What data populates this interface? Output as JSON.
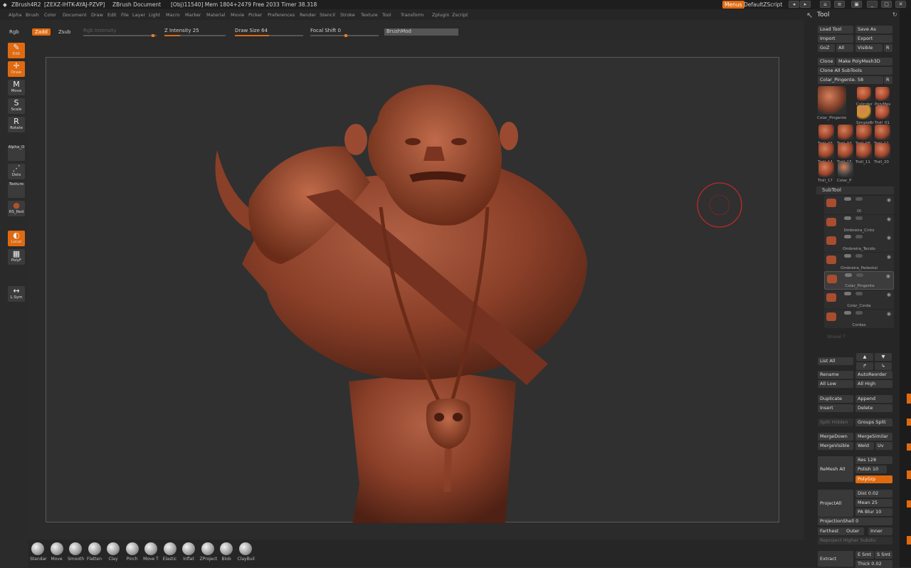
{
  "titlebar": {
    "app": "ZBrush4R2",
    "serial": "[ZEXZ-IHTK-AYAJ-PZVP]",
    "doc": "ZBrush Document",
    "stats": "[Obj)11540] Mem 1804+2479 Free 2033 Timer 38.318",
    "menus_btn": "Menus",
    "script": "DefaultZScript"
  },
  "menubar": [
    "Alpha",
    "Brush",
    "Color",
    "Document",
    "Draw",
    "Edit",
    "File",
    "Layer",
    "Light",
    "Macro",
    "Marker",
    "Material",
    "Movie",
    "Picker",
    "Preferences",
    "Render",
    "Stencil",
    "Stroke",
    "Texture",
    "Tool",
    "Transform",
    "Zplugin",
    "Zscript"
  ],
  "topbar": {
    "rgb": "Rgb",
    "zadd": "Zadd",
    "zsub": "Zsub",
    "rgb_intensity": "Rgb Intensity",
    "z_intensity": "Z Intensity 25",
    "z_intensity_value": 25,
    "draw_size": "Draw Size 64",
    "draw_size_value": 64,
    "focal_shift": "Focal Shift 0",
    "focal_shift_value": 0,
    "brushmod": "BrushMod"
  },
  "left_tools": [
    {
      "label": "Edit",
      "icon": "edit-icon",
      "glyph": "✎",
      "active": true
    },
    {
      "label": "Draw",
      "icon": "draw-icon",
      "glyph": "✛",
      "active": true
    },
    {
      "label": "Move",
      "icon": "move-icon",
      "glyph": "M",
      "active": false
    },
    {
      "label": "Scale",
      "icon": "scale-icon",
      "glyph": "S",
      "active": false
    },
    {
      "label": "Rotate",
      "icon": "rotate-icon",
      "glyph": "R",
      "active": false
    },
    {
      "label": "Alpha_O",
      "icon": "alpha-icon",
      "glyph": "",
      "active": false
    },
    {
      "label": "Dots",
      "icon": "stroke-dots-icon",
      "glyph": "⋰",
      "active": false
    },
    {
      "label": "Texture",
      "icon": "texture-icon",
      "glyph": "",
      "active": false
    },
    {
      "label": "RS_Red",
      "icon": "material-ball-icon",
      "glyph": "●",
      "active": false
    },
    {
      "label": "Local",
      "icon": "local-icon",
      "glyph": "◐",
      "active": true
    },
    {
      "label": "PolyF",
      "icon": "polyframe-icon",
      "glyph": "▦",
      "active": false
    },
    {
      "label": "L.Sym",
      "icon": "local-symmetry-icon",
      "glyph": "↔",
      "active": false
    }
  ],
  "brushes": [
    "Standar",
    "Move",
    "Smooth",
    "Flatten",
    "Clay",
    "Pinch",
    "Move T",
    "Elastic",
    "Inflat",
    "ZProject",
    "Blob",
    "ClayBuil"
  ],
  "tool_panel": {
    "title": "Tool",
    "load": "Load Tool",
    "save": "Save As",
    "import": "Import",
    "export": "Export",
    "goz": "GoZ",
    "all": "All",
    "visible": "Visible",
    "r": "R",
    "clone": "Clone",
    "make_polymesh": "Make PolyMesh3D",
    "clone_all": "Clone All SubTools",
    "current_tool": "Colar_Pingente. 58",
    "thumbs": [
      {
        "name": "Colar_Pingente",
        "big": true
      },
      {
        "name": "Cylinder"
      },
      {
        "name": "PolyMes"
      },
      {
        "name": "SimpleBr"
      },
      {
        "name": "Troll_01"
      },
      {
        "name": "Troll_03"
      },
      {
        "name": "Troll_04"
      },
      {
        "name": "Troll_08"
      },
      {
        "name": "Troll_11"
      },
      {
        "name": "Troll_14"
      },
      {
        "name": "Troll_15"
      },
      {
        "name": "Troll_11"
      },
      {
        "name": "Troll_20"
      },
      {
        "name": "Troll_17"
      },
      {
        "name": "Colar_P"
      }
    ],
    "subtool_title": "SubTool",
    "subtools": [
      "Ol",
      "Ombreira_Cinto",
      "Ombreira_Tecido",
      "Ombreira_Pedestal",
      "Colar_Pingente",
      "Colar_Corda",
      "Cordas"
    ],
    "subtool_selected": 4,
    "faded": "Shovel T",
    "list_all": "List All",
    "rename": "Rename",
    "autoreorder": "AutoReorder",
    "all_low": "All Low",
    "all_high": "All High",
    "duplicate": "Duplicate",
    "append": "Append",
    "insert": "Insert",
    "delete": "Delete",
    "split_hidden": "Split Hidden",
    "groups_split": "Groups Split",
    "mergedown": "MergeDown",
    "mergesimilar": "MergeSimilar",
    "mergevisible": "MergeVisible",
    "weld": "Weld",
    "uv": "Uv",
    "remesh_all": "ReMesh All",
    "res": "Res 128",
    "polish": "Polish 10",
    "polygrp": "PolyGrp",
    "projectall": "ProjectAll",
    "dist": "Dist 0.02",
    "mean": "Mean 25",
    "pa_blur": "PA Blur 10",
    "projectionshell": "ProjectionShell 0",
    "farthest": "Farthest",
    "outer": "Outer",
    "inner": "Inner",
    "reproject": "Reproject Higher Subdiv",
    "extract": "Extract",
    "e_smt": "E Smt",
    "s_smt": "S Smt",
    "thick": "Thick 0.02"
  },
  "colors": {
    "accent": "#e06a10",
    "clay": "#8a3f28",
    "panel": "#262626"
  }
}
